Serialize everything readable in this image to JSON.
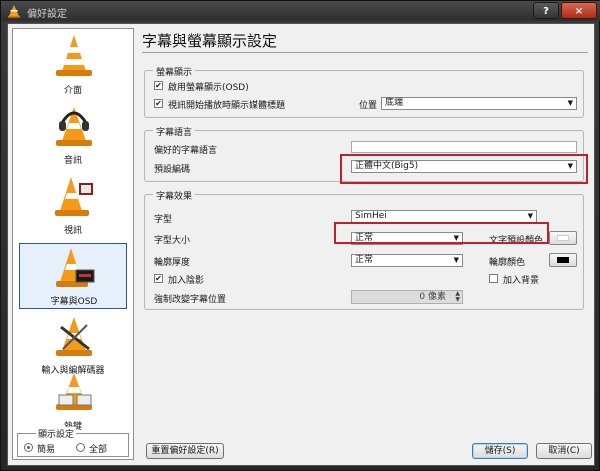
{
  "window": {
    "title": "偏好設定",
    "help_label": "?",
    "close_label": "×"
  },
  "sidebar": {
    "items": [
      {
        "label": "介面"
      },
      {
        "label": "音訊"
      },
      {
        "label": "視訊"
      },
      {
        "label": "字幕與OSD"
      },
      {
        "label": "輸入與編解碼器"
      },
      {
        "label": "熱鍵"
      }
    ],
    "mode": {
      "title": "顯示設定",
      "simple": "簡易",
      "all": "全部",
      "selected": "簡易"
    }
  },
  "main": {
    "title": "字幕與螢幕顯示設定",
    "osd": {
      "title": "螢幕顯示",
      "enable_osd": "啟用螢幕顯示(OSD)",
      "show_title": "視訊開始播放時顯示媒體標題",
      "position_label": "位置",
      "position_value": "底端"
    },
    "lang": {
      "title": "字幕語言",
      "preferred_label": "偏好的字幕語言",
      "preferred_value": "",
      "encoding_label": "預設編碼",
      "encoding_value": "正體中文(Big5)"
    },
    "effects": {
      "title": "字幕效果",
      "font_label": "字型",
      "font_value": "SimHei",
      "size_label": "字型大小",
      "size_value": "正常",
      "outline_label": "輪廓厚度",
      "outline_value": "正常",
      "shadow_label": "加入陰影",
      "force_pos_label": "強制改變字幕位置",
      "force_pos_value": "0 像素",
      "text_color_label": "文字預設顏色",
      "outline_color_label": "輪廓顏色",
      "background_label": "加入背景"
    }
  },
  "buttons": {
    "reset": "重置偏好設定(R)",
    "save": "儲存(S)",
    "cancel": "取消(C)"
  },
  "colors": {
    "text_color": "#ffffff",
    "outline_color": "#000000",
    "highlight": "#c0202a"
  }
}
